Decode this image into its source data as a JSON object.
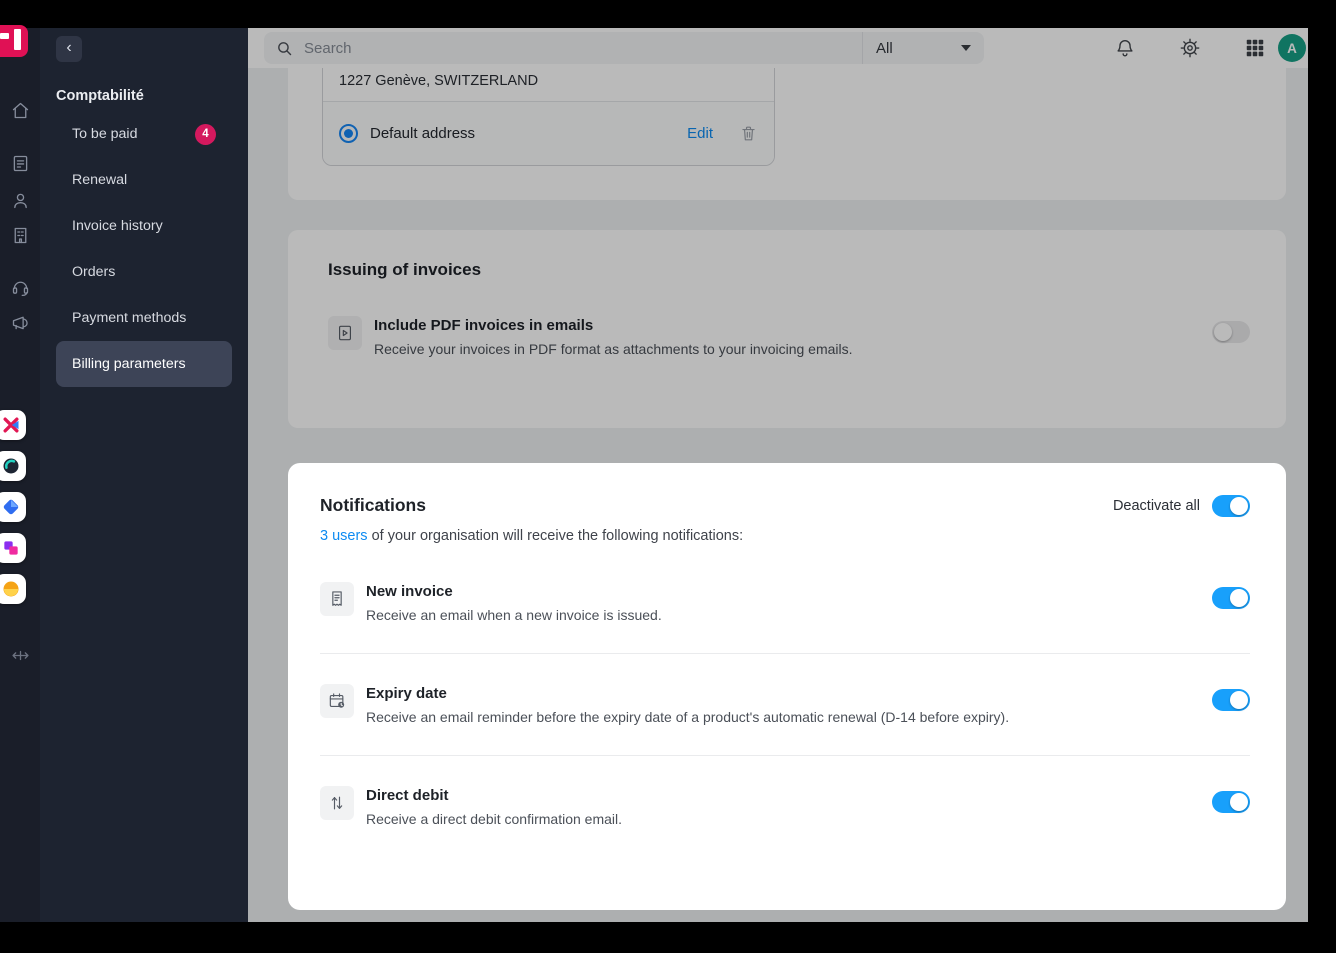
{
  "logo": {
    "name": "infomaniak-logo",
    "color": "#e01155"
  },
  "left_rail": {
    "nav_icons": [
      "home-icon",
      "billing-icon",
      "users-icon",
      "organization-icon",
      "support-icon",
      "announcements-icon"
    ],
    "app_icons": [
      "ksuite-app-icon",
      "kchat-app-icon",
      "kdrive-app-icon",
      "kpaste-app-icon",
      "kmoney-app-icon"
    ],
    "footer_icon": "move-panel-icon"
  },
  "sidebar": {
    "back_icon": "chevron-left-icon",
    "section_title": "Comptabilité",
    "items": [
      {
        "label": "To be paid",
        "badge": "4"
      },
      {
        "label": "Renewal"
      },
      {
        "label": "Invoice history"
      },
      {
        "label": "Orders"
      },
      {
        "label": "Payment methods"
      },
      {
        "label": "Billing parameters",
        "active": true
      }
    ]
  },
  "topbar": {
    "search_placeholder": "Search",
    "filter_value": "All",
    "icons": [
      "bell-icon",
      "gear-icon",
      "apps-grid-icon"
    ],
    "avatar_initial": "A"
  },
  "address_card": {
    "address_line": "1227 Genève, SWITZERLAND",
    "radio_label": "Default address",
    "radio_selected": true,
    "edit_label": "Edit",
    "delete_icon": "trash-icon"
  },
  "invoices_card": {
    "title": "Issuing of invoices",
    "row": {
      "icon": "pdf-invoice-icon",
      "title": "Include PDF invoices in emails",
      "description": "Receive your invoices in PDF format as attachments to your invoicing emails.",
      "enabled": false
    }
  },
  "notifications_card": {
    "title": "Notifications",
    "master_label": "Deactivate all",
    "master_enabled": true,
    "subtitle_link": "3 users",
    "subtitle_rest": " of your organisation will receive the following notifications:",
    "rows": [
      {
        "icon": "invoice-icon",
        "title": "New invoice",
        "description": "Receive an email when a new invoice is issued.",
        "enabled": true
      },
      {
        "icon": "calendar-expiry-icon",
        "title": "Expiry date",
        "description": "Receive an email reminder before the expiry date of a product's automatic renewal (D-14 before expiry).",
        "enabled": true
      },
      {
        "icon": "direct-debit-icon",
        "title": "Direct debit",
        "description": "Receive a direct debit confirmation email.",
        "enabled": true
      }
    ]
  },
  "colors": {
    "accent_blue": "#0d8bf2",
    "toggle_on": "#18a0fb",
    "badge_pink": "#d4195e",
    "avatar_teal": "#16a085",
    "logo_red": "#e01155"
  }
}
